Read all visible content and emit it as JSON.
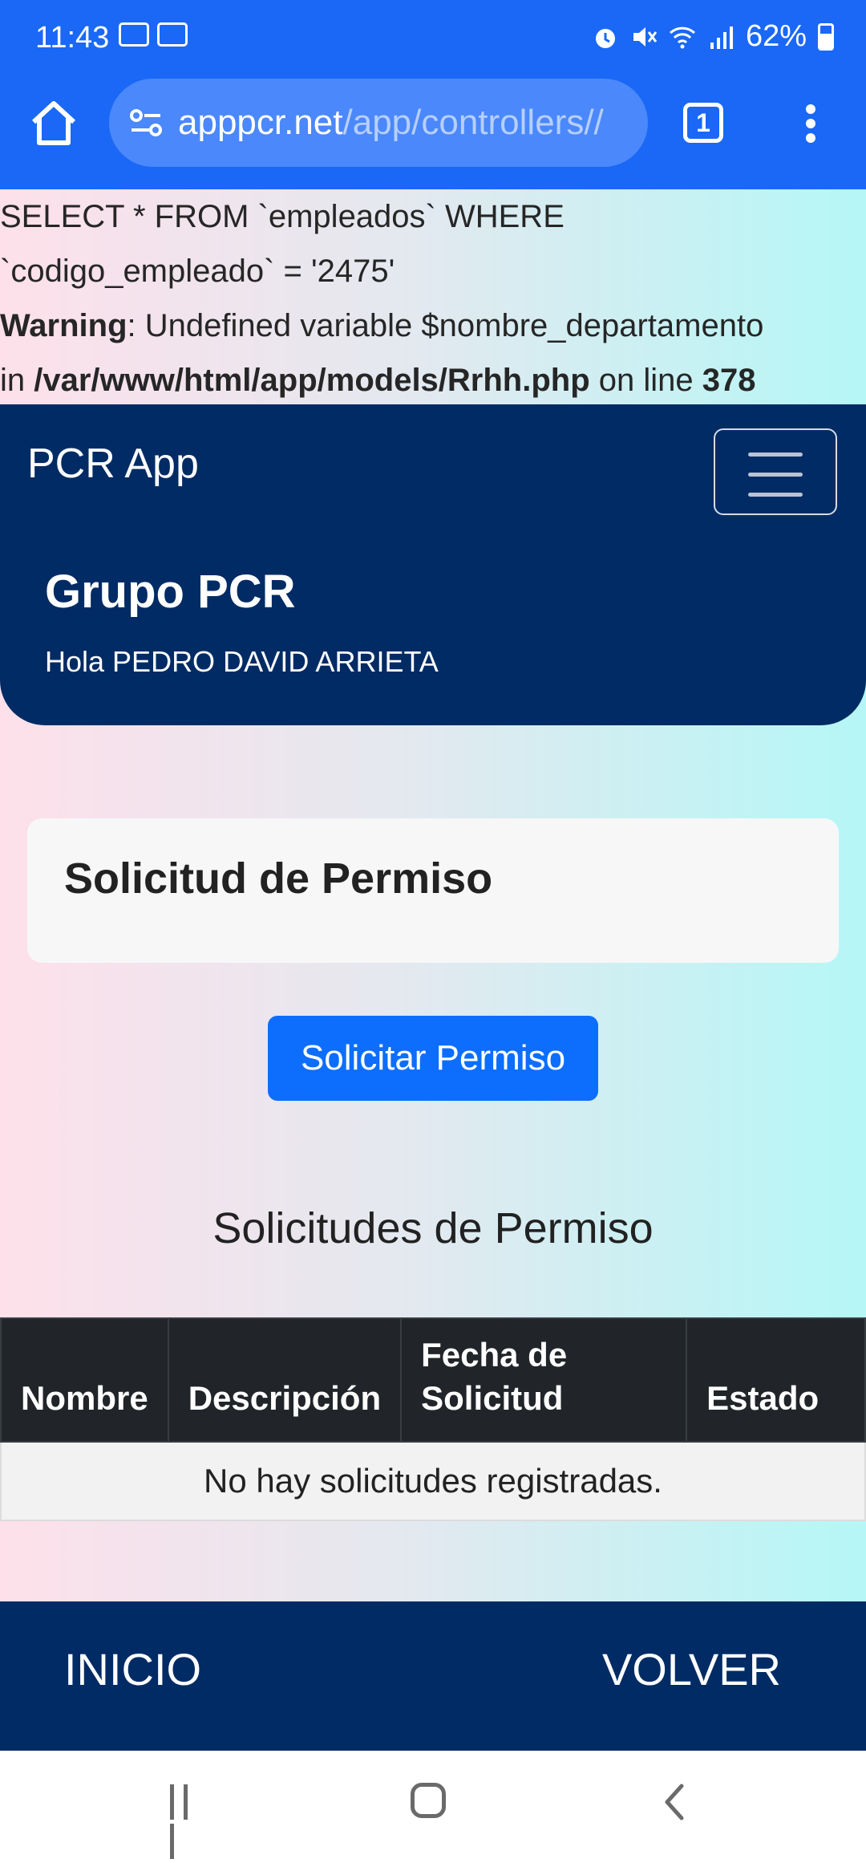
{
  "status_bar": {
    "time": "11:43",
    "battery": "62%",
    "battery_level": 0.62,
    "icons": [
      "outlook-icon",
      "outlook-icon",
      "alarm-icon",
      "mute-icon",
      "wifi-icon",
      "signal-icon",
      "battery-icon"
    ]
  },
  "browser": {
    "url_host": "apppcr.net",
    "url_path": "/app/controllers//",
    "tab_count": "1"
  },
  "php_output": {
    "sql_line1": "SELECT * FROM `empleados` WHERE",
    "sql_line2": "`codigo_empleado` = '2475'",
    "warning_label": "Warning",
    "warning_text": ": Undefined variable $nombre_departamento",
    "in_text": "in ",
    "file_path": "/var/www/html/app/models/Rrhh.php",
    "on_line_text": " on line ",
    "line_number": "378"
  },
  "navbar": {
    "brand": "PCR App",
    "title": "Grupo PCR",
    "greeting": "Hola PEDRO DAVID ARRIETA"
  },
  "card": {
    "title": "Solicitud de Permiso"
  },
  "button": {
    "label": "Solicitar Permiso"
  },
  "list": {
    "title": "Solicitudes de Permiso",
    "columns": [
      "Nombre",
      "Descripción",
      "Fecha de Solicitud",
      "Estado"
    ],
    "empty_message": "No hay solicitudes registradas."
  },
  "bottom_nav": {
    "home": "INICIO",
    "back": "VOLVER"
  },
  "colors": {
    "browser_blue": "#1a68f5",
    "navy": "#012b64",
    "primary": "#0d6efd",
    "table_header": "#212529"
  }
}
